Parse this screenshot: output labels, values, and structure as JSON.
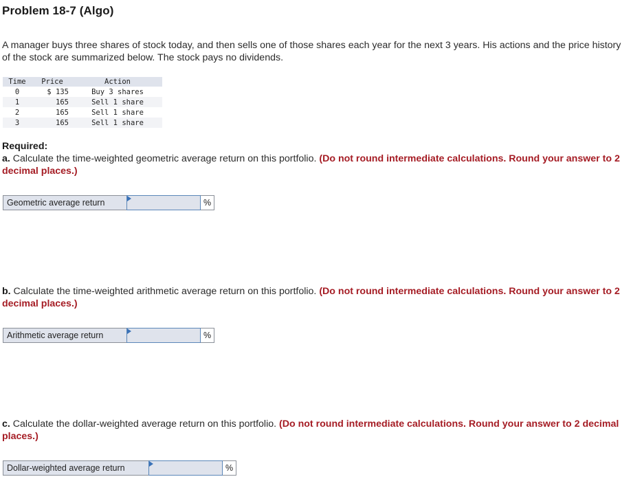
{
  "title": "Problem 18-7 (Algo)",
  "intro": "A manager buys three shares of stock today, and then sells one of those shares each year for the next 3 years. His actions and the price history of the stock are summarized below. The stock pays no dividends.",
  "table": {
    "headers": [
      "Time",
      "Price",
      "Action"
    ],
    "rows": [
      {
        "time": "0",
        "price": "$ 135",
        "action": "Buy 3 shares"
      },
      {
        "time": "1",
        "price": "165",
        "action": "Sell 1 share"
      },
      {
        "time": "2",
        "price": "165",
        "action": "Sell 1 share"
      },
      {
        "time": "3",
        "price": "165",
        "action": "Sell 1 share"
      }
    ]
  },
  "required_label": "Required:",
  "questions": [
    {
      "letter": "a.",
      "text": " Calculate the time-weighted geometric average return on this portfolio. ",
      "note": "(Do not round intermediate calculations. Round your answer to 2 decimal places.)",
      "answer_label": "Geometric average return",
      "answer_value": "",
      "unit": "%"
    },
    {
      "letter": "b.",
      "text": " Calculate the time-weighted arithmetic average return on this portfolio. ",
      "note": "(Do not round intermediate calculations. Round your answer to 2 decimal places.)",
      "answer_label": "Arithmetic average return",
      "answer_value": "",
      "unit": "%"
    },
    {
      "letter": "c.",
      "text": " Calculate the dollar-weighted average return on this portfolio. ",
      "note": "(Do not round intermediate calculations. Round your answer to 2 decimal places.)",
      "answer_label": "Dollar-weighted average return",
      "answer_value": "",
      "unit": "%"
    }
  ],
  "colors": {
    "note_red": "#a51c24",
    "field_bg": "#dfe3ec",
    "input_border": "#5a86b8",
    "input_marker": "#3a72b8"
  }
}
